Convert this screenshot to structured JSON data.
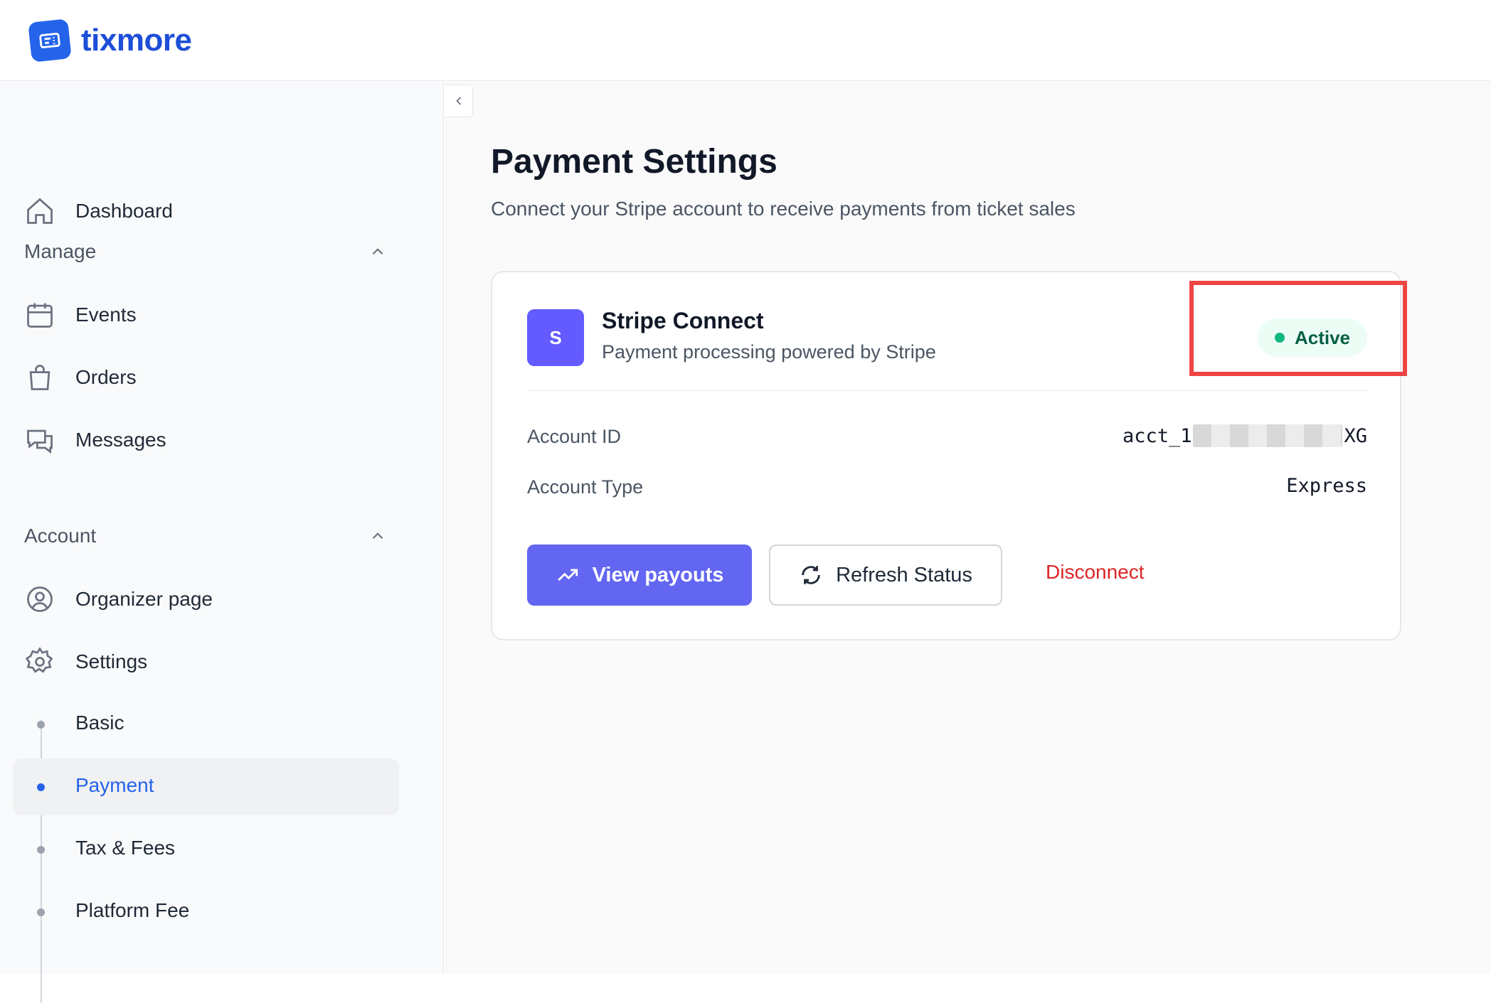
{
  "brand": {
    "name": "tixmore",
    "accent": "#2563eb"
  },
  "sidebar": {
    "dashboard": "Dashboard",
    "manage": {
      "heading": "Manage",
      "items": [
        "Events",
        "Orders",
        "Messages"
      ]
    },
    "account": {
      "heading": "Account",
      "items": [
        "Organizer page",
        "Settings"
      ]
    },
    "settings_sub": [
      "Basic",
      "Payment",
      "Tax & Fees",
      "Platform Fee"
    ],
    "active_sub": "Payment"
  },
  "page": {
    "title": "Payment Settings",
    "subtitle": "Connect your Stripe account to receive payments from ticket sales"
  },
  "card": {
    "badge_letter": "S",
    "title": "Stripe Connect",
    "subtitle": "Payment processing powered by Stripe",
    "status": "Active",
    "status_color": "#10b981",
    "rows": [
      {
        "label": "Account ID",
        "value_prefix": "acct_1",
        "value_suffix": "XG"
      },
      {
        "label": "Account Type",
        "value": "Express"
      }
    ],
    "buttons": {
      "primary": "View payouts",
      "secondary": "Refresh Status",
      "danger": "Disconnect"
    }
  }
}
